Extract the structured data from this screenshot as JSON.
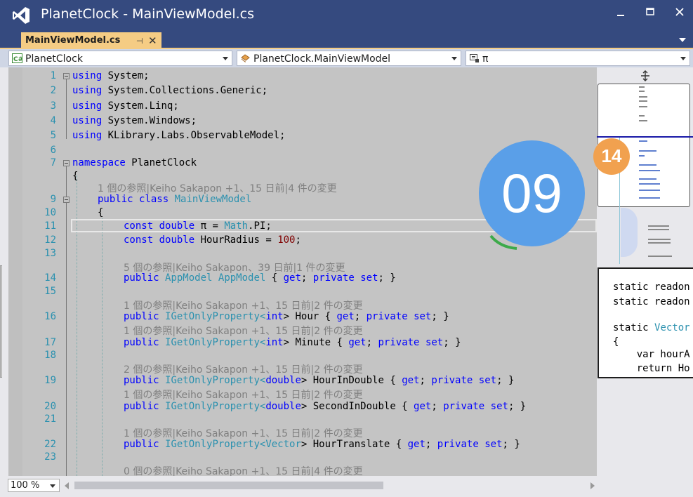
{
  "window": {
    "title": "PlanetClock - MainViewModel.cs",
    "minimize_icon": "minimize-icon",
    "maximize_icon": "maximize-icon",
    "close_icon": "close-icon"
  },
  "tab": {
    "label": "MainViewModel.cs",
    "pin_icon": "pin-icon",
    "close_symbol": "✕"
  },
  "nav": {
    "project": "PlanetClock",
    "class": "PlanetClock.MainViewModel",
    "member": "π"
  },
  "code_lines": [
    {
      "num": "1",
      "text": "using System;"
    },
    {
      "num": "2",
      "text": "using System.Collections.Generic;"
    },
    {
      "num": "3",
      "text": "using System.Linq;"
    },
    {
      "num": "4",
      "text": "using System.Windows;"
    },
    {
      "num": "5",
      "text": "using KLibrary.Labs.ObservableModel;"
    },
    {
      "num": "6",
      "text": ""
    },
    {
      "num": "7",
      "text": "namespace PlanetClock"
    },
    {
      "num": "",
      "text": "{"
    },
    {
      "num": "",
      "hint": "1 個の参照|Keiho Sakapon +1、15 日前|4 件の変更"
    },
    {
      "num": "9",
      "text": "public class MainViewModel"
    },
    {
      "num": "10",
      "text": "{"
    },
    {
      "num": "11",
      "text": "const double π = Math.PI;"
    },
    {
      "num": "12",
      "text": "const double HourRadius = 100;"
    },
    {
      "num": "13",
      "text": ""
    },
    {
      "num": "",
      "hint": "5 個の参照|Keiho Sakapon、39 日前|1 件の変更"
    },
    {
      "num": "14",
      "text": "public AppModel AppModel { get; private set; }"
    },
    {
      "num": "15",
      "text": ""
    },
    {
      "num": "",
      "hint": "1 個の参照|Keiho Sakapon +1、15 日前|2 件の変更"
    },
    {
      "num": "16",
      "text": "public IGetOnlyProperty<int> Hour { get; private set; }"
    },
    {
      "num": "",
      "hint": "1 個の参照|Keiho Sakapon +1、15 日前|2 件の変更"
    },
    {
      "num": "17",
      "text": "public IGetOnlyProperty<int> Minute { get; private set; }"
    },
    {
      "num": "18",
      "text": ""
    },
    {
      "num": "",
      "hint": "2 個の参照|Keiho Sakapon +1、15 日前|2 件の変更"
    },
    {
      "num": "19",
      "text": "public IGetOnlyProperty<double> HourInDouble { get; private set; }"
    },
    {
      "num": "",
      "hint": "1 個の参照|Keiho Sakapon +1、15 日前|2 件の変更"
    },
    {
      "num": "20",
      "text": "public IGetOnlyProperty<double> SecondInDouble { get; private set; }"
    },
    {
      "num": "21",
      "text": ""
    },
    {
      "num": "",
      "hint": "1 個の参照|Keiho Sakapon +1、15 日前|2 件の変更"
    },
    {
      "num": "22",
      "text": "public IGetOnlyProperty<Vector> HourTranslate { get; private set; }"
    },
    {
      "num": "23",
      "text": ""
    },
    {
      "num": "",
      "hint": "0 個の参照|Keiho Sakapon +1、15 日前|4 件の変更"
    }
  ],
  "overlay": {
    "big_number": "09",
    "small_number": "14",
    "big_color": "#5a9fe8",
    "small_color": "#f1a14f"
  },
  "peek": {
    "lines": [
      "static readon",
      "static readon",
      "",
      "static Vector",
      "{",
      "    var hourA",
      "    return Ho"
    ]
  },
  "status": {
    "zoom": "100 %"
  },
  "colors": {
    "keyword": "#0000ff",
    "type": "#2b91af",
    "number": "#800000",
    "tab_active": "#f5cc84",
    "titlebar": "#354a7f"
  }
}
